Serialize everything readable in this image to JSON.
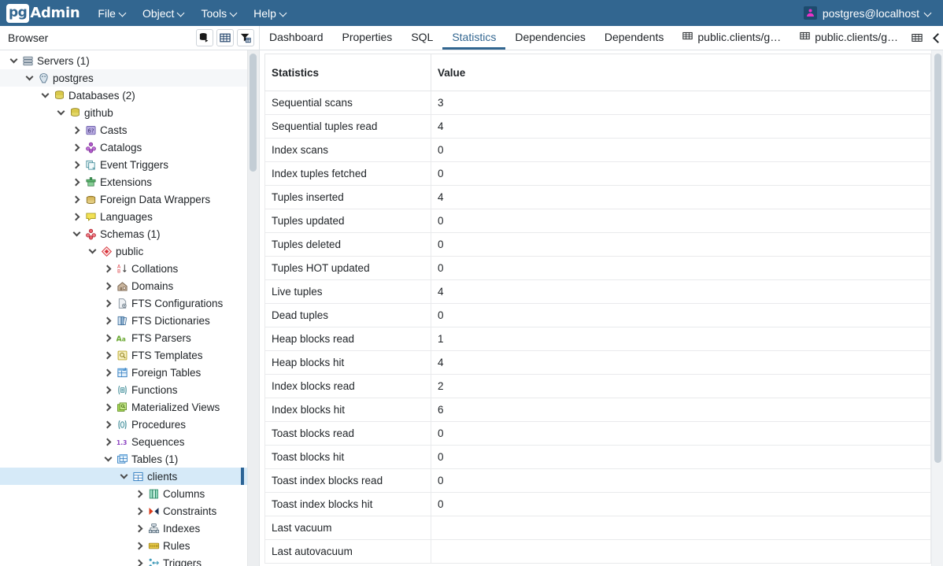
{
  "app": {
    "logo_pg": "pg",
    "logo_admin": "Admin",
    "menu": [
      {
        "label": "File",
        "icon": "chevron-down-icon"
      },
      {
        "label": "Object",
        "icon": "chevron-down-icon"
      },
      {
        "label": "Tools",
        "icon": "chevron-down-icon"
      },
      {
        "label": "Help",
        "icon": "chevron-down-icon"
      }
    ],
    "user": {
      "label": "postgres@localhost",
      "icon": "user-avatar-icon",
      "caret": "chevron-down-icon"
    }
  },
  "browser": {
    "title": "Browser",
    "tools": [
      {
        "name": "query-tool-icon",
        "title": "Query Tool"
      },
      {
        "name": "view-data-icon",
        "title": "View Data"
      },
      {
        "name": "filtered-rows-icon",
        "title": "Filtered Rows"
      }
    ]
  },
  "tabs": {
    "items": [
      {
        "label": "Dashboard",
        "active": false,
        "icon": ""
      },
      {
        "label": "Properties",
        "active": false,
        "icon": ""
      },
      {
        "label": "SQL",
        "active": false,
        "icon": ""
      },
      {
        "label": "Statistics",
        "active": true,
        "icon": ""
      },
      {
        "label": "Dependencies",
        "active": false,
        "icon": ""
      },
      {
        "label": "Dependents",
        "active": false,
        "icon": ""
      },
      {
        "label": "public.clients/g…",
        "active": false,
        "icon": "grid-icon"
      },
      {
        "label": "public.clients/g…",
        "active": false,
        "icon": "grid-icon"
      }
    ],
    "right_controls": [
      {
        "name": "grid-icon"
      },
      {
        "name": "chevron-left-icon"
      },
      {
        "name": "chevron-right-icon"
      }
    ]
  },
  "tree": {
    "nodes": [
      {
        "label": "Servers (1)",
        "depth": 0,
        "state": "open",
        "icon": "servers-icon",
        "selected": false
      },
      {
        "label": "postgres",
        "depth": 1,
        "state": "open",
        "icon": "postgres-elephant-icon",
        "selected": false,
        "hovered": true
      },
      {
        "label": "Databases (2)",
        "depth": 2,
        "state": "open",
        "icon": "databases-icon",
        "selected": false
      },
      {
        "label": "github",
        "depth": 3,
        "state": "open",
        "icon": "database-icon",
        "selected": false
      },
      {
        "label": "Casts",
        "depth": 4,
        "state": "closed",
        "icon": "casts-icon",
        "selected": false
      },
      {
        "label": "Catalogs",
        "depth": 4,
        "state": "closed",
        "icon": "catalogs-icon",
        "selected": false
      },
      {
        "label": "Event Triggers",
        "depth": 4,
        "state": "closed",
        "icon": "event-triggers-icon",
        "selected": false
      },
      {
        "label": "Extensions",
        "depth": 4,
        "state": "closed",
        "icon": "extensions-icon",
        "selected": false
      },
      {
        "label": "Foreign Data Wrappers",
        "depth": 4,
        "state": "closed",
        "icon": "foreign-data-wrappers-icon",
        "selected": false
      },
      {
        "label": "Languages",
        "depth": 4,
        "state": "closed",
        "icon": "languages-icon",
        "selected": false
      },
      {
        "label": "Schemas (1)",
        "depth": 4,
        "state": "open",
        "icon": "schemas-icon",
        "selected": false
      },
      {
        "label": "public",
        "depth": 5,
        "state": "open",
        "icon": "schema-icon",
        "selected": false
      },
      {
        "label": "Collations",
        "depth": 6,
        "state": "closed",
        "icon": "collations-icon",
        "selected": false
      },
      {
        "label": "Domains",
        "depth": 6,
        "state": "closed",
        "icon": "domains-icon",
        "selected": false
      },
      {
        "label": "FTS Configurations",
        "depth": 6,
        "state": "closed",
        "icon": "fts-configurations-icon",
        "selected": false
      },
      {
        "label": "FTS Dictionaries",
        "depth": 6,
        "state": "closed",
        "icon": "fts-dictionaries-icon",
        "selected": false
      },
      {
        "label": "FTS Parsers",
        "depth": 6,
        "state": "closed",
        "icon": "fts-parsers-icon",
        "selected": false
      },
      {
        "label": "FTS Templates",
        "depth": 6,
        "state": "closed",
        "icon": "fts-templates-icon",
        "selected": false
      },
      {
        "label": "Foreign Tables",
        "depth": 6,
        "state": "closed",
        "icon": "foreign-tables-icon",
        "selected": false
      },
      {
        "label": "Functions",
        "depth": 6,
        "state": "closed",
        "icon": "functions-icon",
        "selected": false
      },
      {
        "label": "Materialized Views",
        "depth": 6,
        "state": "closed",
        "icon": "materialized-views-icon",
        "selected": false
      },
      {
        "label": "Procedures",
        "depth": 6,
        "state": "closed",
        "icon": "procedures-icon",
        "selected": false
      },
      {
        "label": "Sequences",
        "depth": 6,
        "state": "closed",
        "icon": "sequences-icon",
        "selected": false
      },
      {
        "label": "Tables (1)",
        "depth": 6,
        "state": "open",
        "icon": "tables-icon",
        "selected": false
      },
      {
        "label": "clients",
        "depth": 7,
        "state": "open",
        "icon": "table-icon",
        "selected": true
      },
      {
        "label": "Columns",
        "depth": 8,
        "state": "closed",
        "icon": "columns-icon",
        "selected": false
      },
      {
        "label": "Constraints",
        "depth": 8,
        "state": "closed",
        "icon": "constraints-icon",
        "selected": false
      },
      {
        "label": "Indexes",
        "depth": 8,
        "state": "closed",
        "icon": "indexes-icon",
        "selected": false
      },
      {
        "label": "Rules",
        "depth": 8,
        "state": "closed",
        "icon": "rules-icon",
        "selected": false
      },
      {
        "label": "Triggers",
        "depth": 8,
        "state": "closed",
        "icon": "triggers-icon",
        "selected": false
      }
    ]
  },
  "statistics": {
    "columns": [
      "Statistics",
      "Value"
    ],
    "rows": [
      {
        "name": "Sequential scans",
        "value": "3"
      },
      {
        "name": "Sequential tuples read",
        "value": "4"
      },
      {
        "name": "Index scans",
        "value": "0"
      },
      {
        "name": "Index tuples fetched",
        "value": "0"
      },
      {
        "name": "Tuples inserted",
        "value": "4"
      },
      {
        "name": "Tuples updated",
        "value": "0"
      },
      {
        "name": "Tuples deleted",
        "value": "0"
      },
      {
        "name": "Tuples HOT updated",
        "value": "0"
      },
      {
        "name": "Live tuples",
        "value": "4"
      },
      {
        "name": "Dead tuples",
        "value": "0"
      },
      {
        "name": "Heap blocks read",
        "value": "1"
      },
      {
        "name": "Heap blocks hit",
        "value": "4"
      },
      {
        "name": "Index blocks read",
        "value": "2"
      },
      {
        "name": "Index blocks hit",
        "value": "6"
      },
      {
        "name": "Toast blocks read",
        "value": "0"
      },
      {
        "name": "Toast blocks hit",
        "value": "0"
      },
      {
        "name": "Toast index blocks read",
        "value": "0"
      },
      {
        "name": "Toast index blocks hit",
        "value": "0"
      },
      {
        "name": "Last vacuum",
        "value": ""
      },
      {
        "name": "Last autovacuum",
        "value": ""
      }
    ]
  },
  "colors": {
    "header_bg": "#326690",
    "accent": "#326690",
    "selection_bg": "#d6eaf8",
    "selection_marker": "#2c6496"
  }
}
